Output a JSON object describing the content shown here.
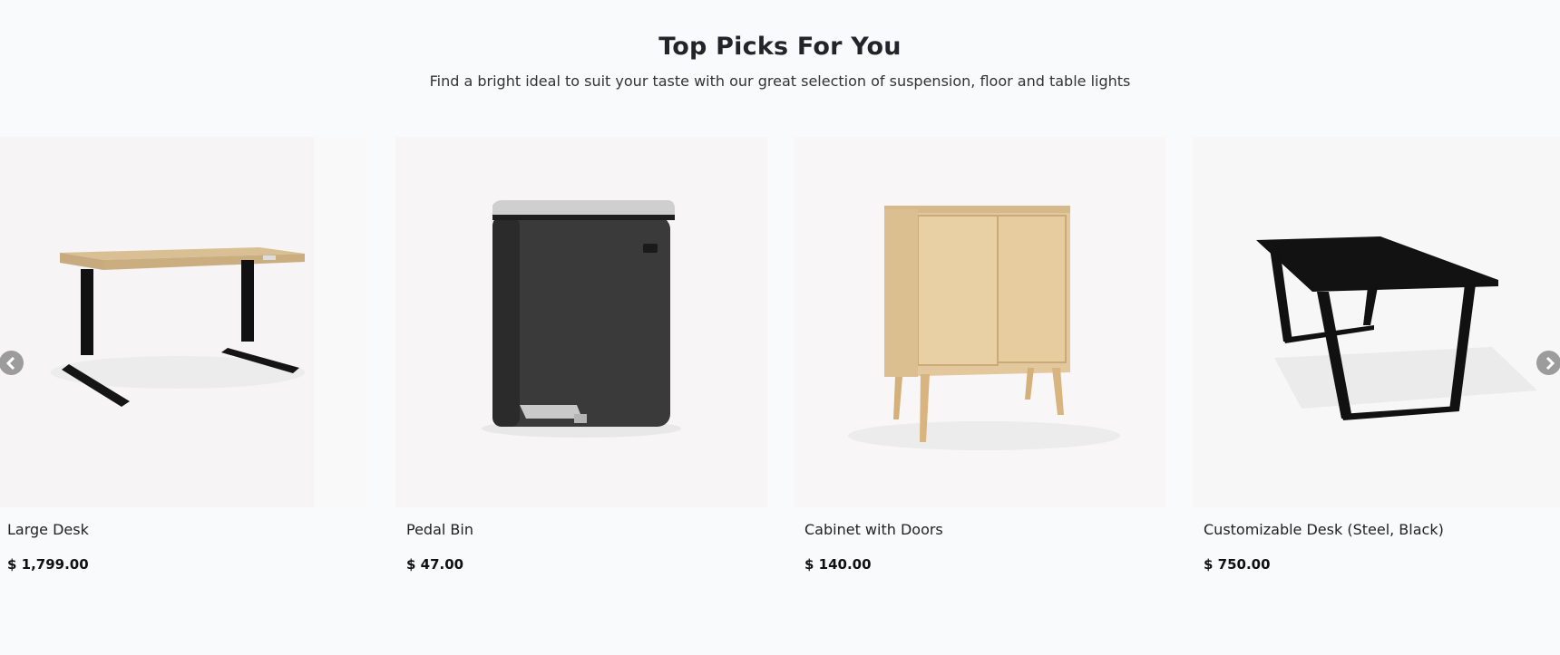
{
  "section": {
    "title": "Top Picks For You",
    "subtitle": "Find a bright ideal to suit your taste with our great selection of suspension, floor and table lights"
  },
  "products": [
    {
      "name": "Large Desk",
      "price": "$ 1,799.00",
      "image": "standing-desk-image"
    },
    {
      "name": "Pedal Bin",
      "price": "$ 47.00",
      "image": "pedal-bin-image"
    },
    {
      "name": "Cabinet with Doors",
      "price": "$ 140.00",
      "image": "cabinet-image"
    },
    {
      "name": "Customizable Desk (Steel, Black)",
      "price": "$ 750.00",
      "image": "black-desk-image"
    }
  ],
  "controls": {
    "prev_icon": "chevron-left-icon",
    "next_icon": "chevron-right-icon",
    "arrow_color": "#9c9c9c"
  }
}
